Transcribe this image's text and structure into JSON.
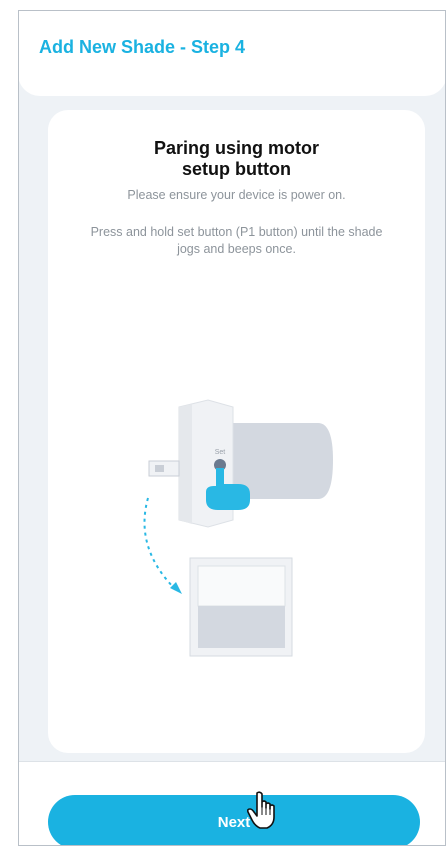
{
  "header": {
    "title": "Add New Shade - Step 4"
  },
  "card": {
    "title_line1": "Paring using motor",
    "title_line2": "setup button",
    "subtitle": "Please ensure your device is power on.",
    "instruction": "Press and hold set button (P1 button) until the shade jogs and beeps once.",
    "illustration": {
      "set_label": "Set"
    }
  },
  "footer": {
    "next_label": "Next"
  },
  "colors": {
    "accent": "#1ab2e1",
    "background": "#eef2f6"
  },
  "icons": [
    "motor-illustration-icon",
    "pointing-hand-icon",
    "shade-icon",
    "hand-cursor-icon"
  ]
}
